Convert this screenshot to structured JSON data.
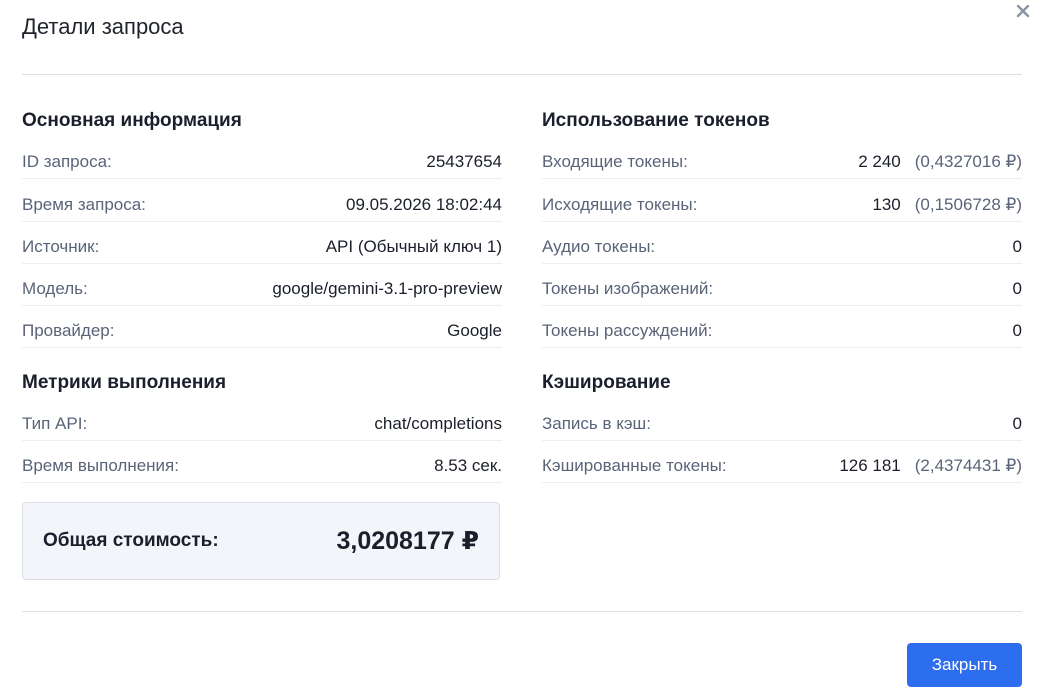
{
  "modal": {
    "title": "Детали запроса",
    "close_button_label": "Закрыть"
  },
  "basic_info": {
    "title": "Основная информация",
    "rows": [
      {
        "label": "ID запроса:",
        "value": "25437654"
      },
      {
        "label": "Время запроса:",
        "value": "09.05.2026 18:02:44"
      },
      {
        "label": "Источник:",
        "value": "API (Обычный ключ 1)"
      },
      {
        "label": "Модель:",
        "value": "google/gemini-3.1-pro-preview"
      },
      {
        "label": "Провайдер:",
        "value": "Google"
      }
    ]
  },
  "metrics": {
    "title": "Метрики выполнения",
    "rows": [
      {
        "label": "Тип API:",
        "value": "chat/completions"
      },
      {
        "label": "Время выполнения:",
        "value": "8.53 сек."
      }
    ]
  },
  "total": {
    "label": "Общая стоимость:",
    "value": "3,0208177 ₽"
  },
  "tokens": {
    "title": "Использование токенов",
    "rows": [
      {
        "label": "Входящие токены:",
        "value": "2 240",
        "cost": "(0,4327016 ₽)"
      },
      {
        "label": "Исходящие токены:",
        "value": "130",
        "cost": "(0,1506728 ₽)"
      },
      {
        "label": "Аудио токены:",
        "value": "0"
      },
      {
        "label": "Токены изображений:",
        "value": "0"
      },
      {
        "label": "Токены рассуждений:",
        "value": "0"
      }
    ]
  },
  "caching": {
    "title": "Кэширование",
    "rows": [
      {
        "label": "Запись в кэш:",
        "value": "0"
      },
      {
        "label": "Кэшированные токены:",
        "value": "126 181",
        "cost": "(2,4374431 ₽)"
      }
    ]
  },
  "icons": {
    "close": "close-icon"
  },
  "colors": {
    "primary": "#2d6df0",
    "label": "#5a6478",
    "total_bg": "#f3f5fa"
  }
}
